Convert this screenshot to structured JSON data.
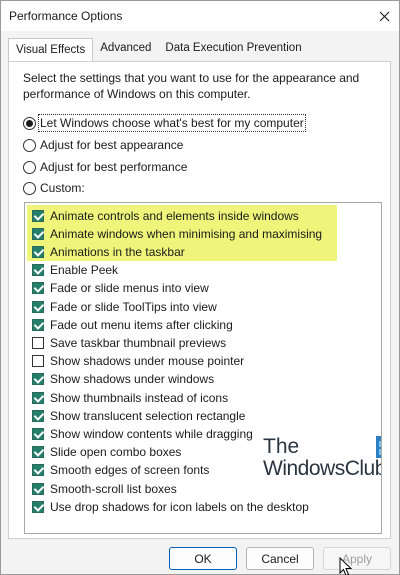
{
  "window": {
    "title": "Performance Options"
  },
  "tabs": [
    {
      "label": "Visual Effects",
      "active": true
    },
    {
      "label": "Advanced",
      "active": false
    },
    {
      "label": "Data Execution Prevention",
      "active": false
    }
  ],
  "description": "Select the settings that you want to use for the appearance and performance of Windows on this computer.",
  "radios": [
    {
      "label": "Let Windows choose what's best for my computer",
      "checked": true
    },
    {
      "label": "Adjust for best appearance",
      "checked": false
    },
    {
      "label": "Adjust for best performance",
      "checked": false
    },
    {
      "label": "Custom:",
      "checked": false
    }
  ],
  "options": [
    {
      "label": "Animate controls and elements inside windows",
      "checked": true
    },
    {
      "label": "Animate windows when minimising and maximising",
      "checked": true
    },
    {
      "label": "Animations in the taskbar",
      "checked": true
    },
    {
      "label": "Enable Peek",
      "checked": true
    },
    {
      "label": "Fade or slide menus into view",
      "checked": true
    },
    {
      "label": "Fade or slide ToolTips into view",
      "checked": true
    },
    {
      "label": "Fade out menu items after clicking",
      "checked": true
    },
    {
      "label": "Save taskbar thumbnail previews",
      "checked": false
    },
    {
      "label": "Show shadows under mouse pointer",
      "checked": false
    },
    {
      "label": "Show shadows under windows",
      "checked": true
    },
    {
      "label": "Show thumbnails instead of icons",
      "checked": true
    },
    {
      "label": "Show translucent selection rectangle",
      "checked": true
    },
    {
      "label": "Show window contents while dragging",
      "checked": true
    },
    {
      "label": "Slide open combo boxes",
      "checked": true
    },
    {
      "label": "Smooth edges of screen fonts",
      "checked": true
    },
    {
      "label": "Smooth-scroll list boxes",
      "checked": true
    },
    {
      "label": "Use drop shadows for icon labels on the desktop",
      "checked": true
    }
  ],
  "watermark": {
    "line1": "The",
    "line2": "WindowsClub"
  },
  "buttons": {
    "ok": "OK",
    "cancel": "Cancel",
    "apply": "Apply"
  },
  "colors": {
    "accent": "#25806b",
    "highlight": "#eef57a"
  }
}
